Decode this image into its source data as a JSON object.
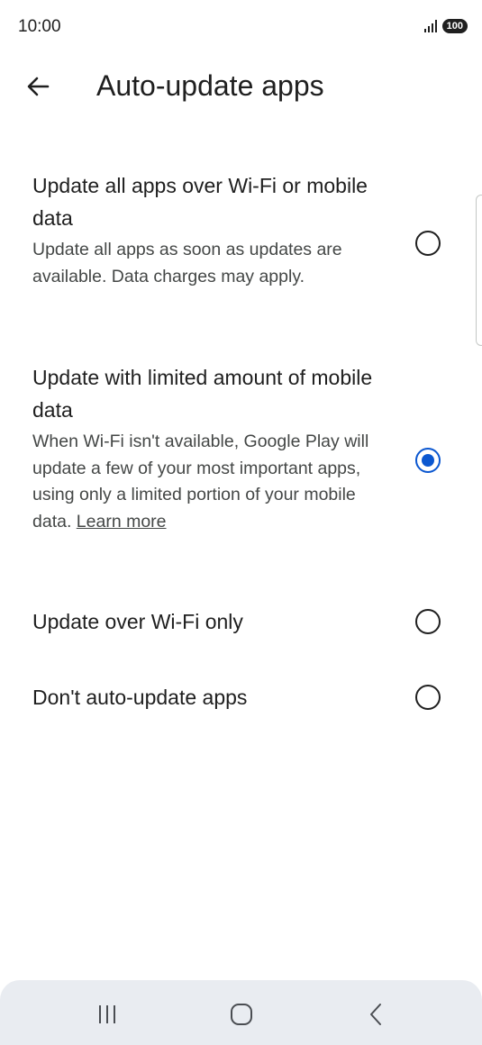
{
  "status_bar": {
    "time": "10:00",
    "battery": "100",
    "signal_icon": "signal-bars-icon"
  },
  "header": {
    "back_icon": "arrow-back-icon",
    "title": "Auto-update apps"
  },
  "options": [
    {
      "title": "Update all apps over Wi-Fi or mobile data",
      "description": "Update all apps as soon as updates are available. Data charges may apply.",
      "selected": false
    },
    {
      "title": "Update with limited amount of mobile data",
      "description": "When Wi-Fi isn't available, Google Play will update a few of your most important apps, using only a limited portion of your mobile data.",
      "link": "Learn more",
      "selected": true
    },
    {
      "title": "Update over Wi-Fi only",
      "selected": false
    },
    {
      "title": "Don't auto-update apps",
      "selected": false
    }
  ],
  "nav_bar": {
    "recents_icon": "recents-icon",
    "home_icon": "home-icon",
    "back_icon": "back-chevron-icon"
  },
  "colors": {
    "accent": "#0b57d0",
    "text_primary": "#1f1f1f",
    "text_secondary": "#444746",
    "nav_background": "#e9ecf1"
  }
}
